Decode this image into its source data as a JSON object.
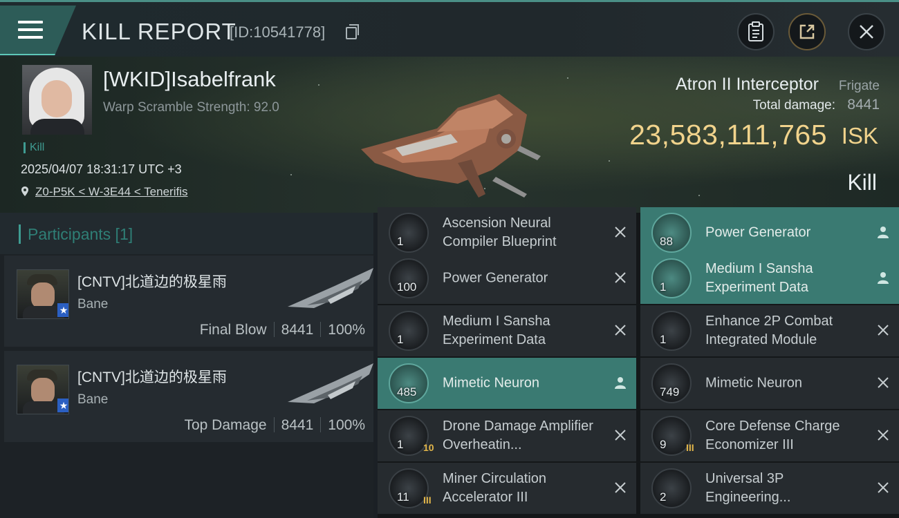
{
  "header": {
    "title": "KILL REPORT",
    "report_id": "[ID:10541778]"
  },
  "victim": {
    "name": "[WKID]Isabelfrank",
    "warp_scramble": "Warp Scramble Strength: 92.0",
    "kill_tag": "Kill",
    "datetime": "2025/04/07 18:31:17 UTC +3",
    "location": "Z0-P5K < W-3E44 < Tenerifis",
    "ship_name": "Atron II Interceptor",
    "ship_class": "Frigate",
    "total_damage_label": "Total damage:",
    "total_damage": "8441",
    "isk_value": "23,583,111,765",
    "isk_unit": "ISK",
    "result": "Kill"
  },
  "participants": {
    "title": "Participants [1]",
    "attackers": [
      {
        "name": "[CNTV]北道边的极星雨",
        "ship": "Bane",
        "role": "Final Blow",
        "damage": "8441",
        "percent": "100%"
      },
      {
        "name": "[CNTV]北道边的极星雨",
        "ship": "Bane",
        "role": "Top Damage",
        "damage": "8441",
        "percent": "100%"
      }
    ]
  },
  "items": [
    {
      "name": "Ascension Neural Compiler Blueprint",
      "qty": "1",
      "dropped": false,
      "icon": "blueprint-icon"
    },
    {
      "name": "Power Generator",
      "qty": "88",
      "dropped": true,
      "icon": "power-generator-icon"
    },
    {
      "name": "Power Generator",
      "qty": "100",
      "dropped": false,
      "icon": "power-generator-icon"
    },
    {
      "name": "Medium I Sansha Experiment Data",
      "qty": "1",
      "dropped": true,
      "icon": "experiment-data-icon"
    },
    {
      "name": "Medium I Sansha Experiment Data",
      "qty": "1",
      "dropped": false,
      "icon": "experiment-data-icon"
    },
    {
      "name": "Enhance 2P Combat Integrated Module",
      "qty": "1",
      "dropped": false,
      "icon": "combat-module-icon"
    },
    {
      "name": "Mimetic Neuron",
      "qty": "485",
      "dropped": true,
      "icon": "neuron-icon"
    },
    {
      "name": "Mimetic Neuron",
      "qty": "749",
      "dropped": false,
      "icon": "neuron-icon"
    },
    {
      "name": "Drone Damage Amplifier Overheatin...",
      "qty": "1",
      "tier": "10",
      "dropped": false,
      "icon": "drone-amplifier-icon"
    },
    {
      "name": "Core Defense Charge Economizer III",
      "qty": "9",
      "tier": "III",
      "dropped": false,
      "icon": "shield-module-icon"
    },
    {
      "name": "Miner Circulation Accelerator III",
      "qty": "11",
      "tier": "III",
      "dropped": false,
      "icon": "mining-module-icon"
    },
    {
      "name": "Universal 3P Engineering...",
      "qty": "2",
      "dropped": false,
      "icon": "engineering-module-icon"
    }
  ],
  "colors": {
    "accent": "#3f9c92",
    "dropped_row": "#3a7a72",
    "isk": "#f1d38c"
  }
}
